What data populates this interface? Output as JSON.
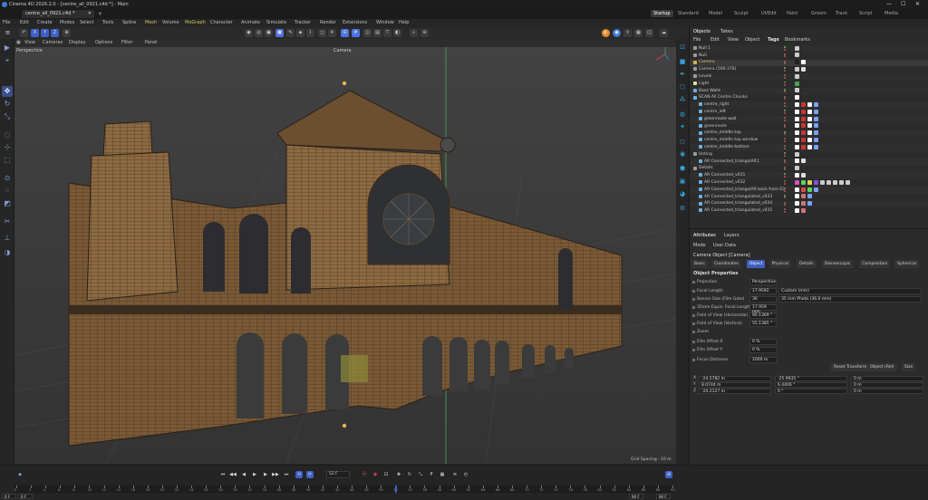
{
  "titlebar": {
    "title": "Cinema 4D 2026.2.0 - [centre_all_0921.c4d *] - Main",
    "minimize": "—",
    "maximize": "☐",
    "close": "✕"
  },
  "file_tab": {
    "label": "centre_all_0921.c4d *",
    "close": "✕",
    "add": "+"
  },
  "layouts": [
    "Startup",
    "Standard",
    "Model",
    "Sculpt",
    "UVEdit",
    "Paint",
    "Groom",
    "Track",
    "Script",
    "Media"
  ],
  "active_layout": "Startup",
  "menubar": [
    "File",
    "Edit",
    "Create",
    "Modes",
    "Select",
    "Tools",
    "Spline",
    "Mesh",
    "Volume",
    "MoGraph",
    "Character",
    "Animate",
    "Simulate",
    "Tracker",
    "Render",
    "Extensions",
    "Window",
    "Help"
  ],
  "menubar_highlight": [
    "Mesh",
    "MoGraph"
  ],
  "viewport_menu": [
    "View",
    "Cameras",
    "Display",
    "Options",
    "Filter",
    "Panel"
  ],
  "viewport": {
    "name": "Perspective",
    "camera": "Camera",
    "grid_spacing": "Grid Spacing : 10 m"
  },
  "objects_panel": {
    "tabs": [
      "Objects",
      "Takes"
    ],
    "menu": [
      "File",
      "Edit",
      "View",
      "Object",
      "Tags",
      "Bookmarks"
    ],
    "rows": [
      {
        "name": "Null 1",
        "indent": 0,
        "color": "#9b9b9b"
      },
      {
        "name": "Null",
        "indent": 0,
        "color": "#9b9b9b"
      },
      {
        "name": "Camera",
        "indent": 0,
        "color": "#d6b04d",
        "hl": true
      },
      {
        "name": "Camera (500-378)",
        "indent": 0,
        "color": "#9b9b9b"
      },
      {
        "name": "Levels",
        "indent": 0,
        "color": "#9b9b9b"
      },
      {
        "name": "Light",
        "indent": 0,
        "color": "#e0e0a0"
      },
      {
        "name": "Base Walls",
        "indent": 0,
        "color": "#6fb0e0"
      },
      {
        "name": "SCAN All Centre Chunks",
        "indent": 0,
        "color": "#6fb0e0"
      },
      {
        "name": "centre_right",
        "indent": 1,
        "color": "#6fb0e0"
      },
      {
        "name": "centre_left",
        "indent": 1,
        "color": "#6fb0e0"
      },
      {
        "name": "greenroute wall",
        "indent": 1,
        "color": "#6fb0e0"
      },
      {
        "name": "greenroute",
        "indent": 1,
        "color": "#6fb0e0"
      },
      {
        "name": "centre_middle top",
        "indent": 1,
        "color": "#6fb0e0"
      },
      {
        "name": "centre_middle top window",
        "indent": 1,
        "color": "#6fb0e0"
      },
      {
        "name": "centre_middle bottom",
        "indent": 1,
        "color": "#6fb0e0"
      },
      {
        "name": "Unting",
        "indent": 0,
        "color": "#9b9b9b"
      },
      {
        "name": "AR Connected_triangulAR1",
        "indent": 1,
        "color": "#6fb0e0"
      },
      {
        "name": "Details",
        "indent": 0,
        "color": "#9b9b9b"
      },
      {
        "name": "AR Connected_v031",
        "indent": 1,
        "color": "#6fb0e0"
      },
      {
        "name": "AR Connected_v032",
        "indent": 1,
        "color": "#6fb0e0"
      },
      {
        "name": "AR Connected_triangulAR back from 03",
        "indent": 1,
        "color": "#6fb0e0"
      },
      {
        "name": "AR Connected_triangulated_v033",
        "indent": 1,
        "color": "#6fb0e0"
      },
      {
        "name": "AR Connected_triangulated_v034",
        "indent": 1,
        "color": "#6fb0e0"
      },
      {
        "name": "AR Connected_triangulated_v035",
        "indent": 1,
        "color": "#6fb0e0"
      }
    ]
  },
  "attributes_panel": {
    "tabs": [
      "Attributes",
      "Layers"
    ],
    "menu": [
      "Mode",
      "User Data"
    ],
    "object_title": "Camera Object [Camera]",
    "subtabs": [
      "Basic",
      "Coordinates",
      "Object",
      "Physical",
      "Details",
      "Stereoscopic",
      "Composition",
      "Spherical"
    ],
    "active_subtab": "Object",
    "section": "Object Properties",
    "fields": [
      {
        "label": "Projection",
        "value": "Perspective",
        "type": "select"
      },
      {
        "label": "Focal Length",
        "value": "17.9592",
        "extra": "Custom (mm)"
      },
      {
        "label": "Sensor Size (Film Gate)",
        "value": "36",
        "extra": "35 mm Photo (36.0 mm)"
      },
      {
        "label": "35mm Equiv. Focal Length",
        "value": "17.959 mm"
      },
      {
        "label": "Field of View (Horizontal)",
        "value": "90.1369 °"
      },
      {
        "label": "Field of View (Vertical)",
        "value": "55.1385 °"
      },
      {
        "label": "Zoom",
        "value": ""
      },
      {
        "label": "Film Offset X",
        "value": "0 %"
      },
      {
        "label": "Film Offset Y",
        "value": "0 %"
      },
      {
        "label": "Focus Distance",
        "value": "2000 m"
      }
    ],
    "transform_buttons": [
      "Reset Transform",
      "Object (Rel)",
      "Size"
    ],
    "coords": [
      {
        "axis": "X",
        "pos": "-24.5782 m",
        "rot": "-25.9935 °",
        "size": "0 m"
      },
      {
        "axis": "Y",
        "pos": "8.0744 m",
        "rot": "6.4406 °",
        "size": "0 m"
      },
      {
        "axis": "Z",
        "pos": "-24.2127 m",
        "rot": "0 °",
        "size": "0 m"
      }
    ]
  },
  "timeline": {
    "frame": "52 F",
    "start": "0 F",
    "start2": "0 F",
    "end": "90 F",
    "end2": "90 F",
    "ticks": [
      "0",
      "2",
      "4",
      "6",
      "8",
      "10",
      "12",
      "14",
      "16",
      "18",
      "20",
      "22",
      "24",
      "26",
      "28",
      "30",
      "32",
      "34",
      "36",
      "38",
      "40",
      "42",
      "44",
      "46",
      "48",
      "50",
      "52",
      "54",
      "56",
      "58",
      "60",
      "62",
      "64",
      "66",
      "68",
      "70",
      "72",
      "74",
      "76",
      "78",
      "80",
      "82",
      "84",
      "86",
      "88",
      "90"
    ]
  },
  "colors": {
    "accent": "#3e60c8",
    "orange": "#e98a23",
    "yellow": "#d6c35c",
    "axis_green": "#4aa35a"
  }
}
